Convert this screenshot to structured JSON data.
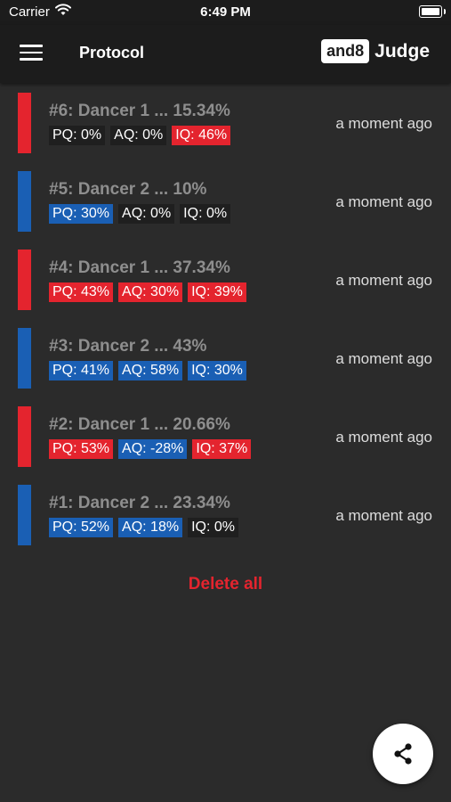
{
  "status": {
    "carrier": "Carrier",
    "time": "6:49 PM"
  },
  "appbar": {
    "title": "Protocol",
    "brand_box": "and8",
    "brand_text": "Judge"
  },
  "colors": {
    "red": "#e4242e",
    "blue": "#1a5fb4",
    "neutral": "#1f1f1f"
  },
  "entries": [
    {
      "title": "#6: Dancer 1 ... 15.34%",
      "bar": "red",
      "time": "a moment ago",
      "badges": [
        {
          "label": "PQ: 0%",
          "color": "neutral"
        },
        {
          "label": "AQ: 0%",
          "color": "neutral"
        },
        {
          "label": "IQ: 46%",
          "color": "red"
        }
      ]
    },
    {
      "title": "#5: Dancer 2 ... 10%",
      "bar": "blue",
      "time": "a moment ago",
      "badges": [
        {
          "label": "PQ: 30%",
          "color": "blue"
        },
        {
          "label": "AQ: 0%",
          "color": "neutral"
        },
        {
          "label": "IQ: 0%",
          "color": "neutral"
        }
      ]
    },
    {
      "title": "#4: Dancer 1 ... 37.34%",
      "bar": "red",
      "time": "a moment ago",
      "badges": [
        {
          "label": "PQ: 43%",
          "color": "red"
        },
        {
          "label": "AQ: 30%",
          "color": "red"
        },
        {
          "label": "IQ: 39%",
          "color": "red"
        }
      ]
    },
    {
      "title": "#3: Dancer 2 ... 43%",
      "bar": "blue",
      "time": "a moment ago",
      "badges": [
        {
          "label": "PQ: 41%",
          "color": "blue"
        },
        {
          "label": "AQ: 58%",
          "color": "blue"
        },
        {
          "label": "IQ: 30%",
          "color": "blue"
        }
      ]
    },
    {
      "title": "#2: Dancer 1 ... 20.66%",
      "bar": "red",
      "time": "a moment ago",
      "badges": [
        {
          "label": "PQ: 53%",
          "color": "red"
        },
        {
          "label": "AQ: -28%",
          "color": "blue"
        },
        {
          "label": "IQ: 37%",
          "color": "red"
        }
      ]
    },
    {
      "title": "#1: Dancer 2 ... 23.34%",
      "bar": "blue",
      "time": "a moment ago",
      "badges": [
        {
          "label": "PQ: 52%",
          "color": "blue"
        },
        {
          "label": "AQ: 18%",
          "color": "blue"
        },
        {
          "label": "IQ: 0%",
          "color": "neutral"
        }
      ]
    }
  ],
  "actions": {
    "delete_all": "Delete all"
  },
  "icons": {
    "menu": "hamburger-menu-icon",
    "share": "share-icon",
    "wifi": "wifi-icon",
    "battery": "battery-icon"
  }
}
